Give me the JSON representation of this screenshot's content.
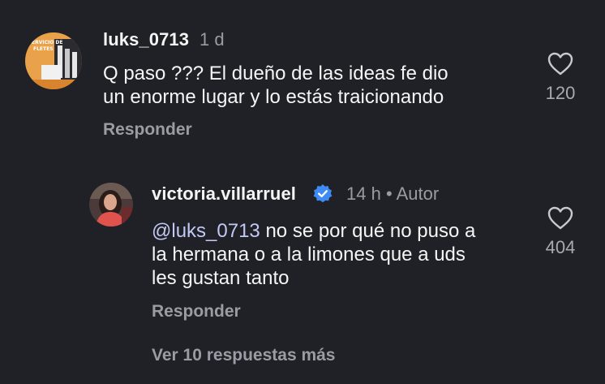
{
  "comment1": {
    "username": "luks_0713",
    "time": "1 d",
    "text": "Q paso ??? El dueño de las ideas fe dio un enorme lugar y lo estás traicionando",
    "line1": "Q paso ??? El dueño de las ideas fe dio",
    "line2": "un enorme lugar y lo estás traicionando",
    "reply_label": "Responder",
    "likes": "120",
    "avatar_text": "ERVICIO DE FLETES"
  },
  "comment2": {
    "username": "victoria.villarruel",
    "verified": true,
    "time": "14 h",
    "separator": "•",
    "author_label": "Autor",
    "mention": "@luks_0713",
    "line1_rest": " no se por qué no puso a",
    "line2": "la hermana o a la limones que a uds",
    "line3": "les gustan tanto",
    "reply_label": "Responder",
    "likes": "404"
  },
  "more_replies": "Ver 10 respuestas más",
  "colors": {
    "background": "#1f2126",
    "verified": "#3e8bf3",
    "secondary_text": "#9a9ca3"
  }
}
